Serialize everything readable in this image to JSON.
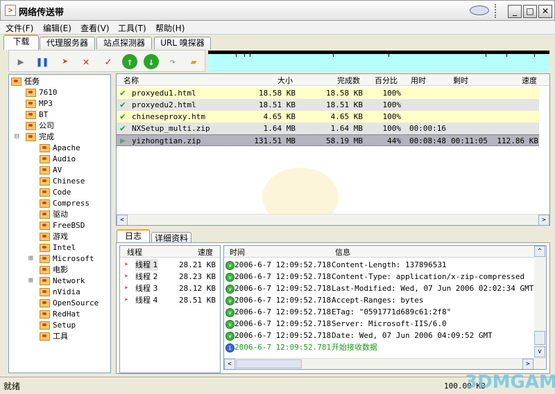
{
  "window": {
    "title": "网络传送带",
    "minimize": "_",
    "maximize": "□",
    "close": "✕"
  },
  "menu": [
    "文件(F)",
    "编辑(E)",
    "查看(V)",
    "工具(T)",
    "帮助(H)"
  ],
  "tabs": [
    "下载",
    "代理服务器",
    "站点探测器",
    "URL 嗅探器"
  ],
  "toolbar": {
    "icons": [
      "start-icon",
      "pause-icon",
      "resume-icon",
      "delete-icon",
      "check-icon",
      "move-up-icon",
      "move-down-icon",
      "open-icon",
      "folder-icon"
    ]
  },
  "tree": {
    "root": "任务",
    "items": [
      "7610",
      "MP3",
      "BT",
      "公司"
    ],
    "expanded": "完成",
    "children": [
      "Apache",
      "Audio",
      "AV",
      "Chinese",
      "Code",
      "Compress",
      "驱动",
      "FreeBSD",
      "游戏",
      "Intel",
      "Microsoft",
      "电影",
      "Network",
      "nVidia",
      "OpenSource",
      "RedHat",
      "Setup",
      "工具"
    ],
    "collapsed_with_children": [
      "Microsoft",
      "Network"
    ]
  },
  "downloads": {
    "columns": [
      "名称",
      "大小",
      "完成数",
      "百分比",
      "用时",
      "剩时",
      "速度"
    ],
    "rows": [
      {
        "name": "proxyedu1.html",
        "size": "18.58 KB",
        "done": "18.58 KB",
        "pct": "100%",
        "elapsed": "",
        "remain": "",
        "speed": "",
        "status": "complete"
      },
      {
        "name": "proxyedu2.html",
        "size": "18.51 KB",
        "done": "18.51 KB",
        "pct": "100%",
        "elapsed": "",
        "remain": "",
        "speed": "",
        "status": "complete"
      },
      {
        "name": "chineseproxy.htm",
        "size": "4.65 KB",
        "done": "4.65 KB",
        "pct": "100%",
        "elapsed": "",
        "remain": "",
        "speed": "",
        "status": "complete"
      },
      {
        "name": "NXSetup_multi.zip",
        "size": "1.64 MB",
        "done": "1.64 MB",
        "pct": "100%",
        "elapsed": "00:00:16",
        "remain": "",
        "speed": "",
        "status": "complete"
      },
      {
        "name": "yizhongtian.zip",
        "size": "131.51 MB",
        "done": "58.19 MB",
        "pct": "44%",
        "elapsed": "00:08:48",
        "remain": "00:11:05",
        "speed": "112.86 KB",
        "status": "downloading"
      }
    ]
  },
  "bottom_tabs": [
    "日志",
    "详细资料"
  ],
  "threads": {
    "columns": [
      "线程",
      "速度"
    ],
    "rows": [
      {
        "name": "线程 1",
        "speed": "28.21 KB"
      },
      {
        "name": "线程 2",
        "speed": "28.23 KB"
      },
      {
        "name": "线程 3",
        "speed": "28.12 KB"
      },
      {
        "name": "线程 4",
        "speed": "28.51 KB"
      }
    ]
  },
  "log": {
    "columns": [
      "时间",
      "信息"
    ],
    "rows": [
      {
        "time": "2006-6-7 12:09:52.718",
        "msg": "Content-Length: 137896531",
        "type": "ok"
      },
      {
        "time": "2006-6-7 12:09:52.718",
        "msg": "Content-Type: application/x-zip-compressed",
        "type": "ok"
      },
      {
        "time": "2006-6-7 12:09:52.718",
        "msg": "Last-Modified: Wed, 07 Jun 2006 02:02:34 GMT",
        "type": "ok"
      },
      {
        "time": "2006-6-7 12:09:52.718",
        "msg": "Accept-Ranges: bytes",
        "type": "ok"
      },
      {
        "time": "2006-6-7 12:09:52.718",
        "msg": "ETag: \"0591771d689c61:2f8\"",
        "type": "ok"
      },
      {
        "time": "2006-6-7 12:09:52.718",
        "msg": "Server: Microsoft-IIS/6.0",
        "type": "ok"
      },
      {
        "time": "2006-6-7 12:09:52.718",
        "msg": "Date: Wed, 07 Jun 2006 04:09:52 GMT",
        "type": "ok"
      },
      {
        "time": "2006-6-7 12:09:52.781",
        "msg": "开始接收数据",
        "type": "info"
      }
    ]
  },
  "status": {
    "text": "就绪",
    "speed": "100.00 KB"
  },
  "watermark": "3DMGAME",
  "colors": {
    "complete_row": "#ffffc8",
    "alt_row": "#e4e4e4",
    "selected_row": "#b4b4c0",
    "info_text": "#1a9a1a",
    "graph_bg": "#b5ffff"
  }
}
